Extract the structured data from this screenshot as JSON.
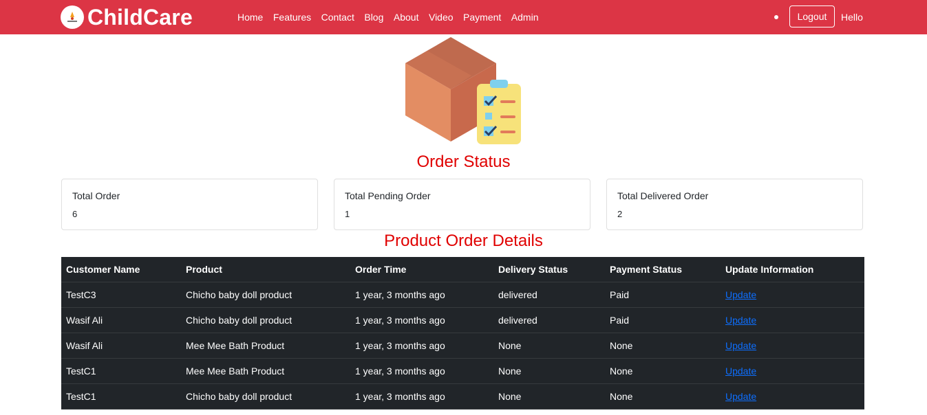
{
  "brand": {
    "name": "ChildCare",
    "logo_icon": "childcare-logo-icon"
  },
  "nav": {
    "links": [
      "Home",
      "Features",
      "Contact",
      "Blog",
      "About",
      "Video",
      "Payment",
      "Admin"
    ],
    "logout_label": "Logout",
    "greeting": "Hello"
  },
  "colors": {
    "navbar": "#dc3545",
    "heading": "#e00000",
    "table_bg": "#212529",
    "link": "#0d6efd"
  },
  "order_status": {
    "title": "Order Status",
    "cards": [
      {
        "label": "Total Order",
        "value": "6"
      },
      {
        "label": "Total Pending Order",
        "value": "1"
      },
      {
        "label": "Total Delivered Order",
        "value": "2"
      }
    ]
  },
  "order_details": {
    "title": "Product Order Details",
    "columns": [
      "Customer Name",
      "Product",
      "Order Time",
      "Delivery Status",
      "Payment Status",
      "Update Information"
    ],
    "rows": [
      {
        "customer": "TestC3",
        "product": "Chicho baby doll product",
        "time": "1 year, 3 months ago",
        "delivery": "delivered",
        "payment": "Paid",
        "action": "Update"
      },
      {
        "customer": "Wasif Ali",
        "product": "Chicho baby doll product",
        "time": "1 year, 3 months ago",
        "delivery": "delivered",
        "payment": "Paid",
        "action": "Update"
      },
      {
        "customer": "Wasif Ali",
        "product": "Mee Mee Bath Product",
        "time": "1 year, 3 months ago",
        "delivery": "None",
        "payment": "None",
        "action": "Update"
      },
      {
        "customer": "TestC1",
        "product": "Mee Mee Bath Product",
        "time": "1 year, 3 months ago",
        "delivery": "None",
        "payment": "None",
        "action": "Update"
      },
      {
        "customer": "TestC1",
        "product": "Chicho baby doll product",
        "time": "1 year, 3 months ago",
        "delivery": "None",
        "payment": "None",
        "action": "Update"
      }
    ]
  }
}
